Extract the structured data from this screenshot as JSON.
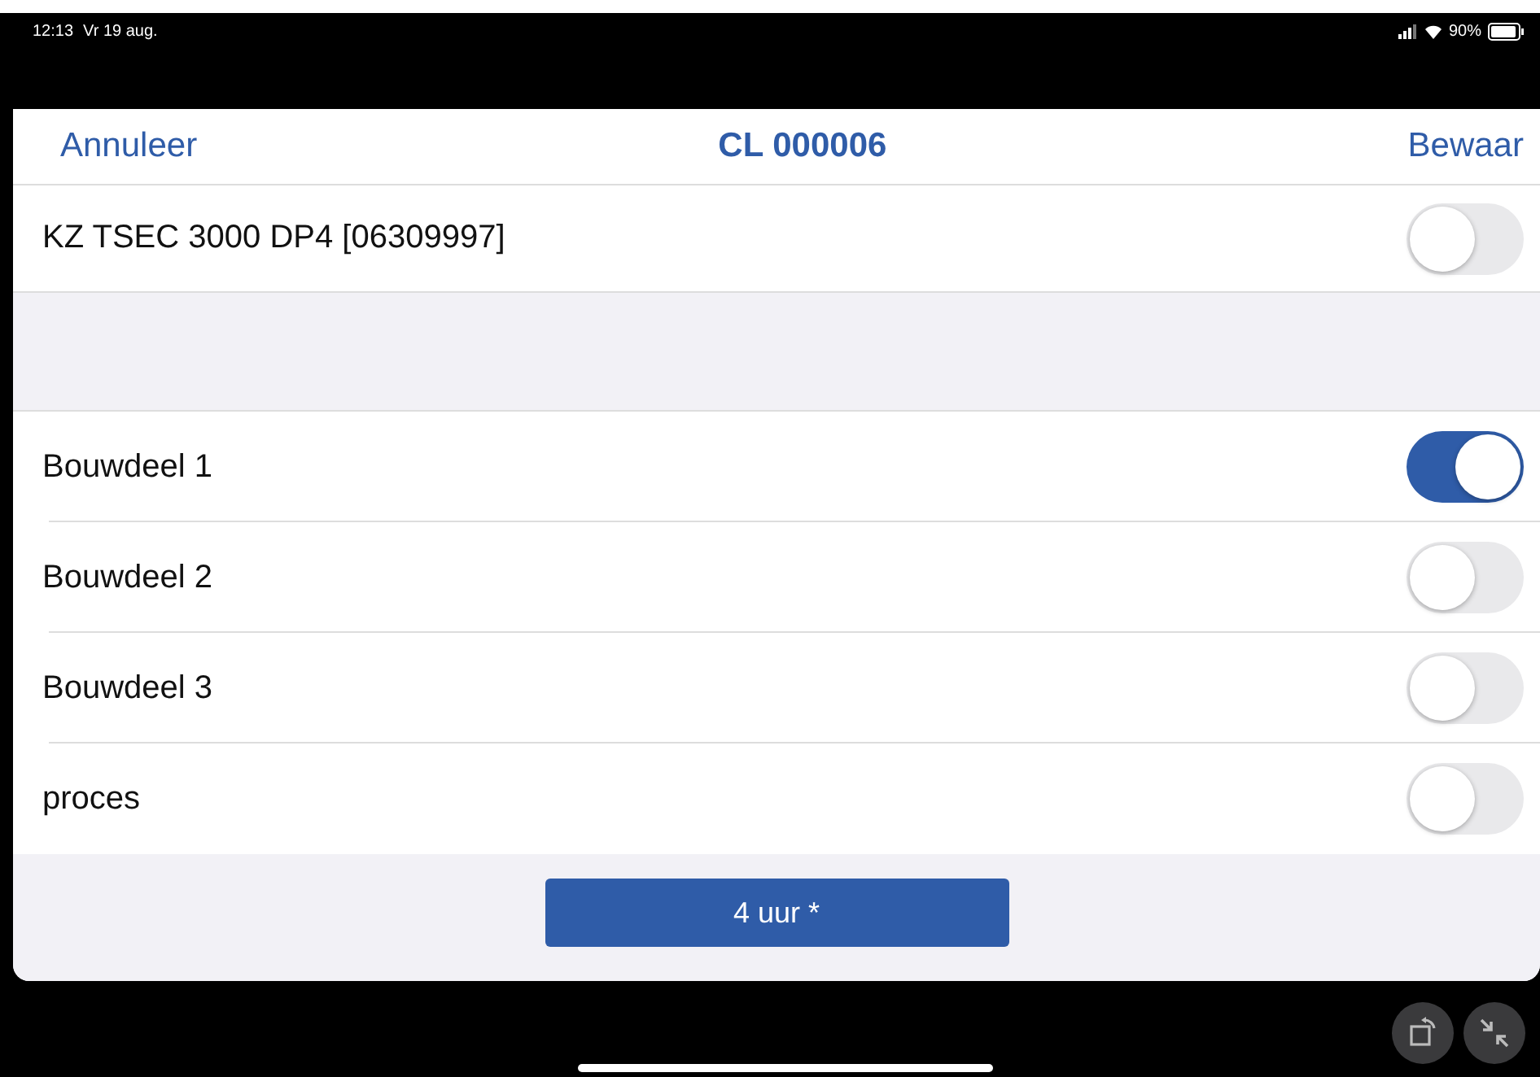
{
  "status_bar": {
    "time": "12:13",
    "date": "Vr 19 aug.",
    "battery": "90%"
  },
  "nav": {
    "cancel": "Annuleer",
    "title": "CL 000006",
    "save": "Bewaar"
  },
  "header_row": {
    "label": "KZ TSEC 3000 DP4 [06309997]",
    "on": false
  },
  "items": [
    {
      "label": "Bouwdeel 1",
      "on": true
    },
    {
      "label": "Bouwdeel 2",
      "on": false
    },
    {
      "label": "Bouwdeel 3",
      "on": false
    },
    {
      "label": "proces",
      "on": false
    }
  ],
  "footer_button": "4 uur *"
}
